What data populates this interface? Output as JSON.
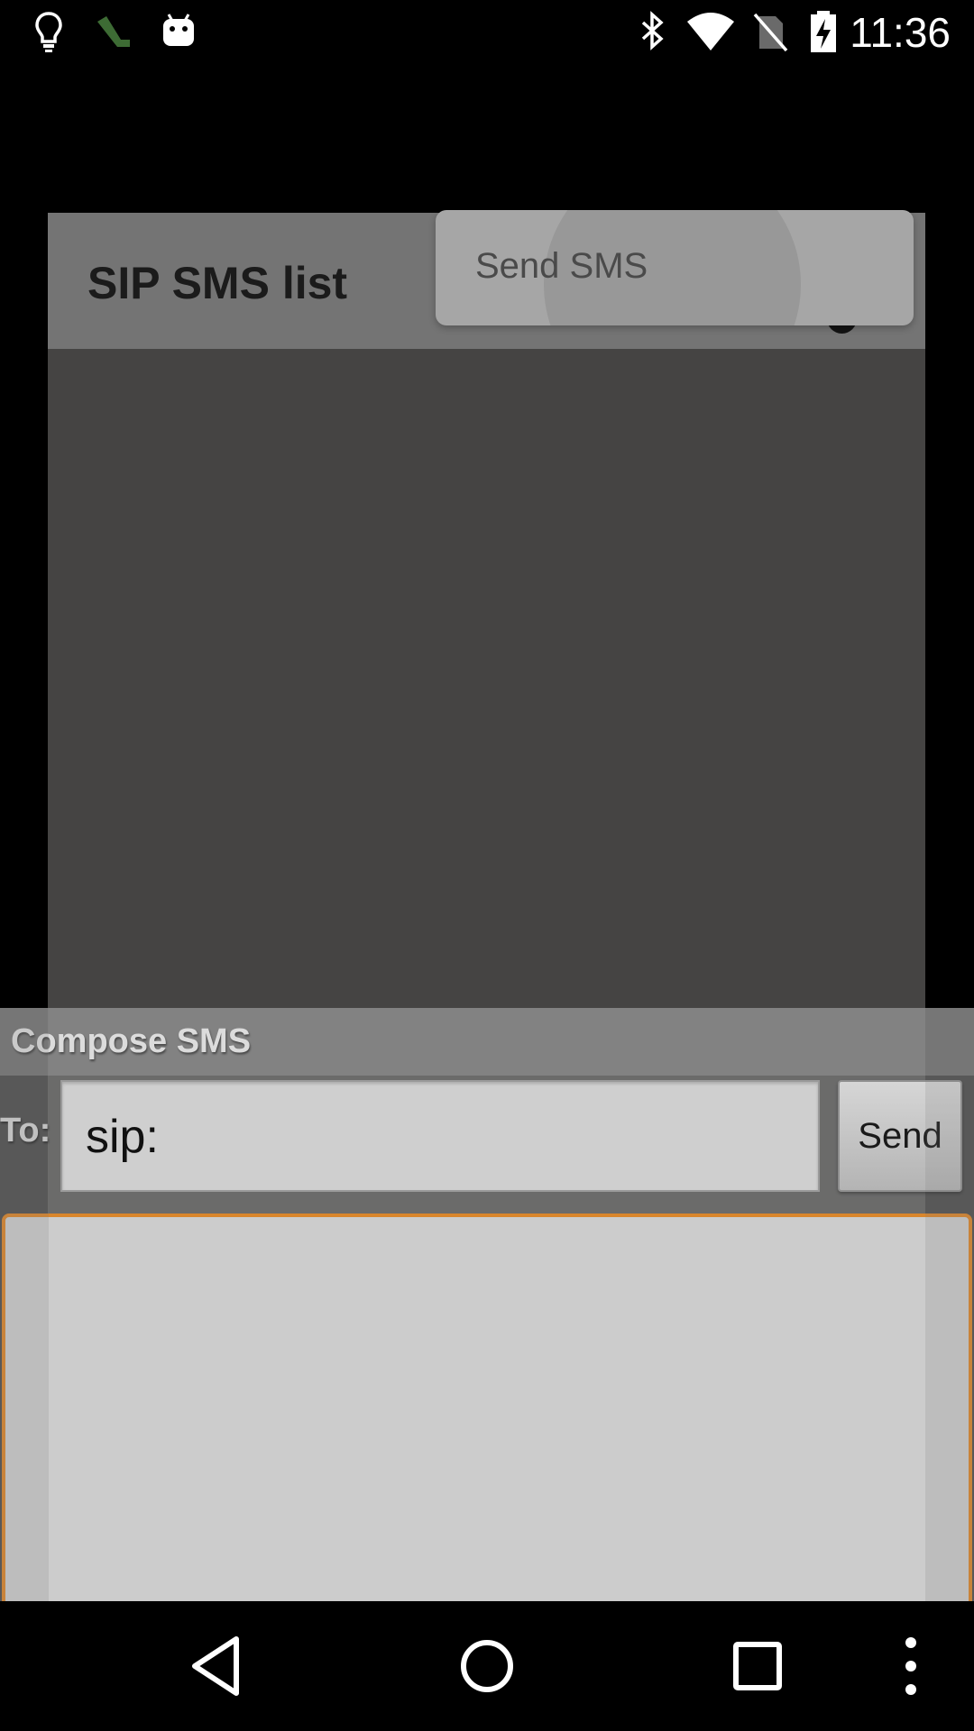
{
  "status_bar": {
    "time": "11:36",
    "left_icons": [
      "lightbulb-icon",
      "app-notification-icon",
      "android-icon"
    ],
    "right_icons": [
      "bluetooth-icon",
      "wifi-icon",
      "no-sim-icon",
      "battery-charging-icon"
    ]
  },
  "app": {
    "title": "SIP SMS list",
    "overflow_icon": "more-vert-icon"
  },
  "popup_menu": {
    "items": [
      {
        "label": "Send SMS"
      }
    ]
  },
  "compose": {
    "title": "Compose SMS",
    "to_label": "To:",
    "to_value": "sip:",
    "send_label": "Send",
    "message_value": ""
  },
  "nav_bar": {
    "icons": [
      "back-icon",
      "home-icon",
      "recents-icon",
      "menu-icon"
    ]
  },
  "colors": {
    "accent_focus": "#d9862c",
    "app_header": "#747474",
    "app_background": "#454443"
  }
}
